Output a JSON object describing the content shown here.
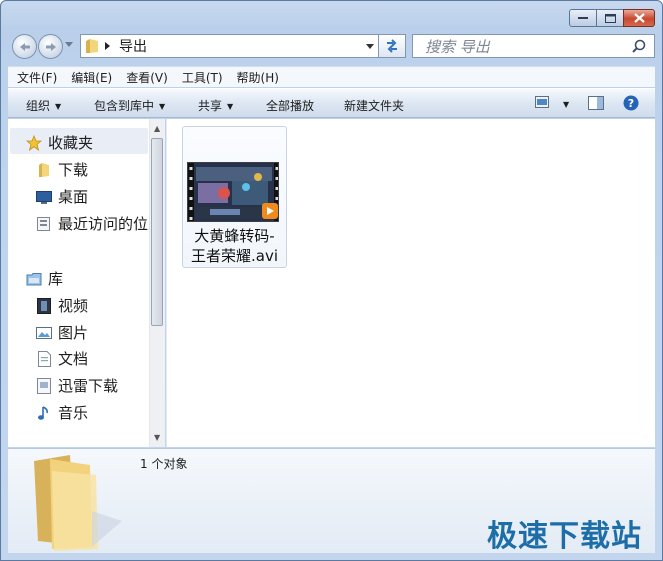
{
  "address": {
    "folder": "导出"
  },
  "search": {
    "placeholder": "搜索 导出"
  },
  "menu": [
    "文件(F)",
    "编辑(E)",
    "查看(V)",
    "工具(T)",
    "帮助(H)"
  ],
  "toolbar": {
    "organize": "组织",
    "include_library": "包含到库中",
    "share": "共享",
    "play_all": "全部播放",
    "new_folder": "新建文件夹"
  },
  "nav": {
    "favorites": "收藏夹",
    "downloads": "下载",
    "desktop": "桌面",
    "recent": "最近访问的位置",
    "libraries": "库",
    "videos": "视频",
    "pictures": "图片",
    "documents": "文档",
    "thunder": "迅雷下载",
    "music": "音乐"
  },
  "files": [
    {
      "name_line1": "大黄蜂转码-",
      "name_line2": "王者荣耀.avi"
    }
  ],
  "status": {
    "count": "1 个对象"
  },
  "watermark": "极速下载站",
  "icons": {
    "search": "search-icon",
    "refresh": "refresh-icon",
    "help": "help-icon",
    "folder": "folder-icon"
  },
  "colors": {
    "accent": "#1d6ea8",
    "chrome": "#bcd2ec"
  }
}
